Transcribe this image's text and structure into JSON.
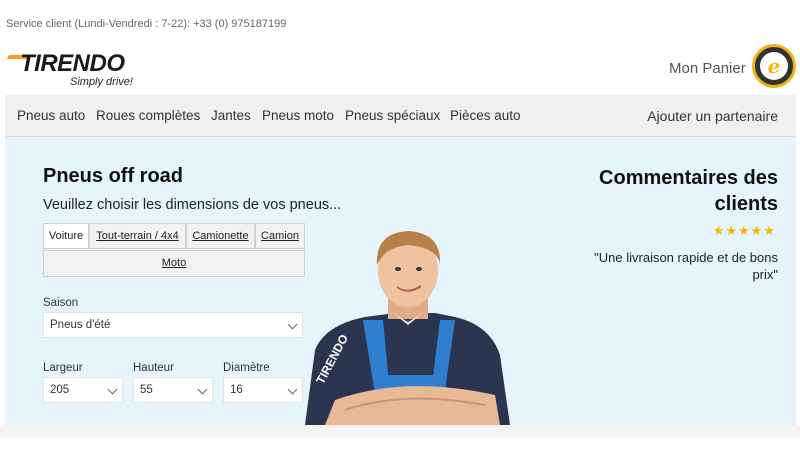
{
  "topbar": {
    "service": "Service client (Lundi-Vendredi : 7-22): +33 (0) 975187199"
  },
  "brand": {
    "name": "TIRENDO",
    "tagline": "Simply drive!",
    "trust_badge_letter": "e",
    "accent": "#f6a01a"
  },
  "header": {
    "cart_label": "Mon Panier"
  },
  "nav": {
    "items": [
      "Pneus auto",
      "Roues complètes",
      "Jantes",
      "Pneus moto",
      "Pneus spéciaux",
      "Pièces auto"
    ],
    "partner": "Ajouter un partenaire"
  },
  "search": {
    "title": "Pneus off road",
    "subtitle": "Veuillez choisir les dimensions de vos pneus...",
    "tabs": [
      "Voiture",
      "Tout-terrain / 4x4",
      "Camionette",
      "Camion"
    ],
    "tab_moto": "Moto",
    "season_label": "Saison",
    "season_value": "Pneus d'été",
    "width_label": "Largeur",
    "width_value": "205",
    "height_label": "Hauteur",
    "height_value": "55",
    "diameter_label": "Diamètre",
    "diameter_value": "16"
  },
  "reviews": {
    "title": "Commentaires des clients",
    "stars": "★★★★★",
    "quote": "\"Une livraison rapide et de bons prix\"",
    "rating": 5
  },
  "colors": {
    "hero_bg": "#e5f5fb",
    "nav_bg": "#f0f0f0",
    "star": "#f6b400"
  }
}
